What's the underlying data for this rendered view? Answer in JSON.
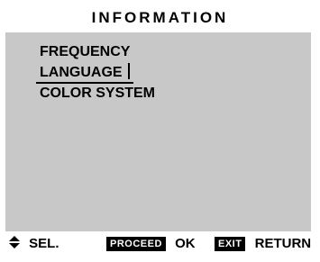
{
  "menu": {
    "title": "INFORMATION",
    "items": [
      "FREQUENCY",
      "LANGUAGE",
      "COLOR SYSTEM"
    ],
    "selected_index": 1
  },
  "footer": {
    "sel_label": "SEL.",
    "proceed_box": "PROCEED",
    "ok_label": "OK",
    "exit_box": "EXIT",
    "return_label": "RETURN"
  }
}
